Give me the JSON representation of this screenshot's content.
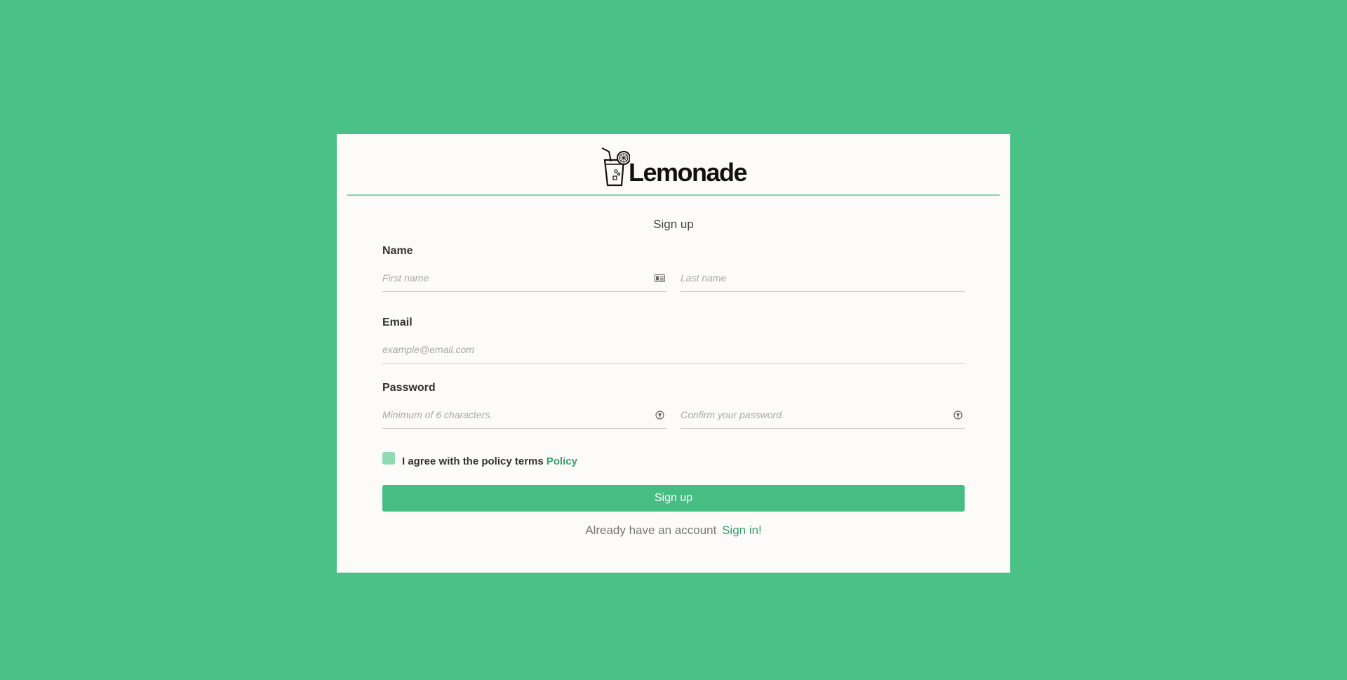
{
  "brand": {
    "name": "Lemonade",
    "accent_color": "#4ac186"
  },
  "form": {
    "title": "Sign up",
    "name_section": {
      "label": "Name",
      "first_name_placeholder": "First name",
      "last_name_placeholder": "Last name",
      "first_name_icon": "id-card-icon"
    },
    "email_section": {
      "label": "Email",
      "email_placeholder": "example@email.com"
    },
    "password_section": {
      "label": "Password",
      "password_placeholder": "Minimum of 6 characters.",
      "confirm_placeholder": "Confirm your password.",
      "password_icon": "eye-icon",
      "confirm_icon": "eye-icon"
    },
    "agreement": {
      "checked": false,
      "text": "I agree with the policy terms",
      "policy_link": "Policy"
    },
    "submit_label": "Sign up",
    "footer": {
      "text": "Already have an account",
      "link": "Sign in!"
    }
  }
}
